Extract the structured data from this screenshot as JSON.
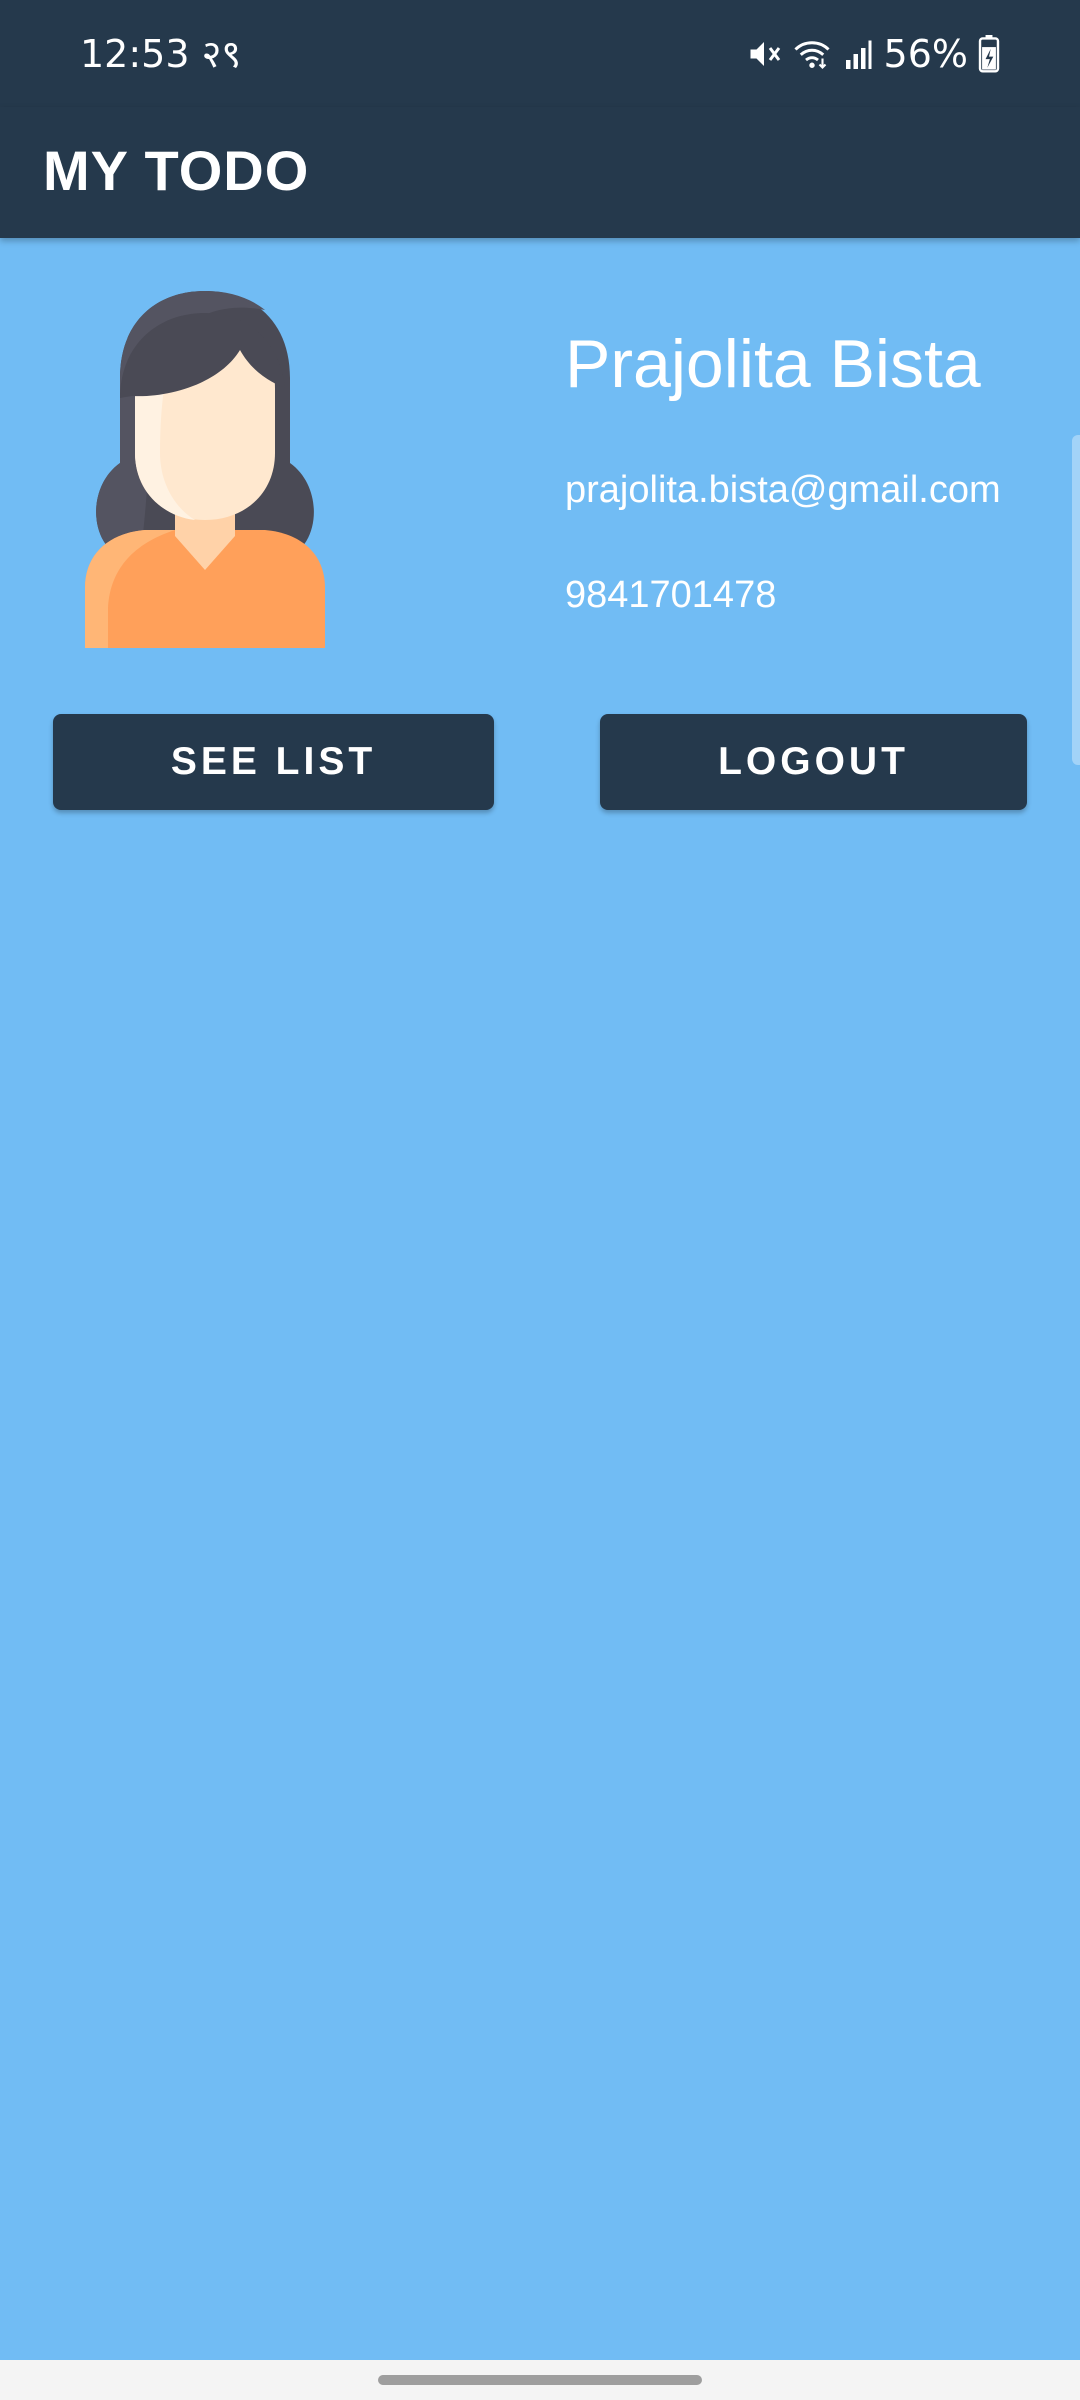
{
  "status_bar": {
    "time": "12:53 २९",
    "battery_percent": "56%",
    "icons": [
      "mute-icon",
      "wifi-icon",
      "signal-icon",
      "battery-charging-icon"
    ]
  },
  "app_bar": {
    "title": "MY TODO"
  },
  "profile": {
    "avatar_icon": "female-avatar-icon",
    "name": "Prajolita Bista",
    "email": "prajolita.bista@gmail.com",
    "phone": "9841701478"
  },
  "actions": {
    "see_list_label": "SEE LIST",
    "logout_label": "LOGOUT"
  },
  "colors": {
    "background": "#71bcf4",
    "primary_dark": "#25394c",
    "text_on_primary": "#ffffff"
  }
}
